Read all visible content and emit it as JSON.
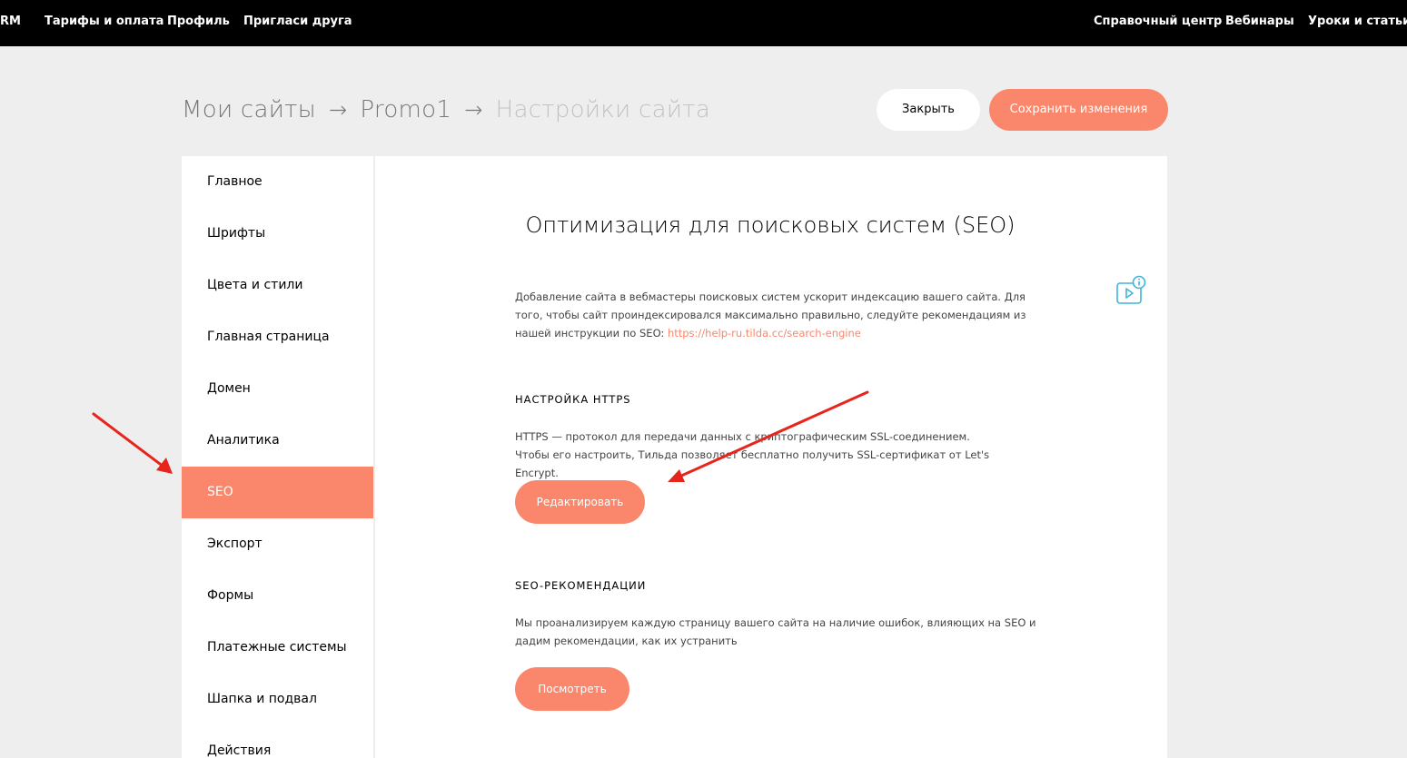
{
  "topnav": {
    "left": [
      "RM",
      "Тарифы и оплата",
      "Профиль",
      "Пригласи друга"
    ],
    "right": [
      "Справочный центр",
      "Вебинары",
      "Уроки и статьи"
    ]
  },
  "breadcrumb": {
    "items": [
      "Мои сайты",
      "Promo1",
      "Настройки сайта"
    ],
    "separator": "→"
  },
  "header_buttons": {
    "close": "Закрыть",
    "save": "Сохранить изменения"
  },
  "sidebar": {
    "active_index": 6,
    "items": [
      "Главное",
      "Шрифты",
      "Цвета и стили",
      "Главная страница",
      "Домен",
      "Аналитика",
      "SEO",
      "Экспорт",
      "Формы",
      "Платежные системы",
      "Шапка и подвал",
      "Действия"
    ]
  },
  "main": {
    "title": "Оптимизация для поисковых систем (SEO)",
    "intro_text": "Добавление сайта в вебмастеры поисковых систем ускорит индексацию вашего сайта. Для того, чтобы сайт проиндексировался максимально правильно, следуйте рекомендациям из нашей инструкции по SEO: ",
    "intro_link": "https://help-ru.tilda.cc/search-engine",
    "https_section": {
      "heading": "НАСТРОЙКА HTTPS",
      "text": "HTTPS — протокол для передачи данных с криптографическим SSL-соединением. Чтобы его настроить, Тильда позволяет бесплатно получить SSL-сертификат от Let's Encrypt.",
      "button": "Редактировать"
    },
    "seo_section": {
      "heading": "SEO-РЕКОМЕНДАЦИИ",
      "text": "Мы проанализируем каждую страницу вашего сайта на наличие ошибок, влияющих на SEO и дадим рекомендации, как их устранить",
      "button": "Посмотреть"
    }
  },
  "colors": {
    "accent": "#fa876b",
    "topbar": "#000000",
    "page_bg": "#eeeeee",
    "info_icon": "#3fb6d8",
    "annotation_arrow": "#e8251d"
  },
  "icons": [
    "video-info-icon",
    "annotation-arrow"
  ]
}
